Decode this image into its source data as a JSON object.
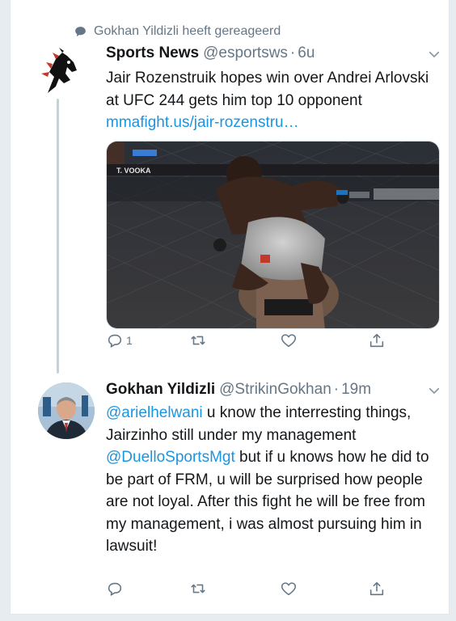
{
  "context": {
    "text": "Gokhan Yildizli heeft gereageerd",
    "icon": "speech-bubble-icon"
  },
  "tweets": [
    {
      "name": "Sports News",
      "handle": "@esportsws",
      "separator": "·",
      "time": "6u",
      "text_plain": "Jair Rozenstruik hopes win over Andrei Arlovski at UFC 244 gets him top 10 opponent ",
      "link": "mmafight.us/jair-rozenstru…",
      "reply_count": "1",
      "avatar": "horse-logo-avatar",
      "media_text": "T. VOOKA"
    },
    {
      "name": "Gokhan Yildizli",
      "handle": "@StrikinGokhan",
      "separator": "·",
      "time": "19m",
      "mention1": "@arielhelwani",
      "text_part1": " u know the interresting things, Jairzinho still under my management ",
      "mention2": "@DuelloSportsMgt",
      "text_part2": " but if u knows how he did to be part of FRM, u will be surprised how people are not loyal. After this fight he will be free from my management, i was almost pursuing him in lawsuit!",
      "avatar": "profile-photo-avatar"
    }
  ],
  "colors": {
    "link": "#1b95e0",
    "muted": "#657786",
    "text": "#14171a"
  }
}
